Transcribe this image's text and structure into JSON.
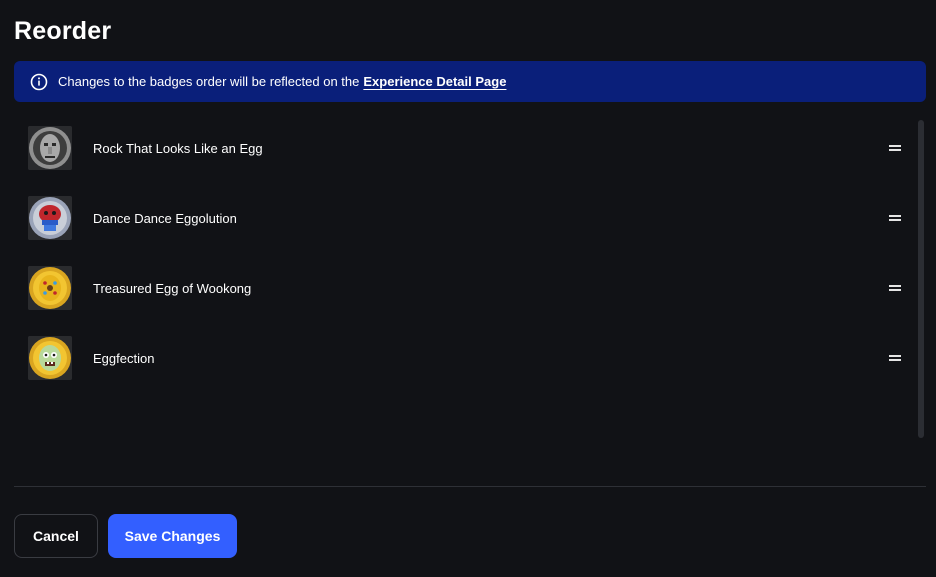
{
  "dialog": {
    "title": "Reorder"
  },
  "banner": {
    "icon": "info-icon",
    "text": "Changes to the badges order will be reflected on the",
    "link_label": "Experience Detail Page",
    "background": "#0a1f7a"
  },
  "badges": [
    {
      "name": "Rock That Looks Like an Egg",
      "icon": "stone-face-badge"
    },
    {
      "name": "Dance Dance Eggolution",
      "icon": "red-bird-badge"
    },
    {
      "name": "Treasured Egg of Wookong",
      "icon": "golden-egg-badge"
    },
    {
      "name": "Eggfection",
      "icon": "zombie-egg-badge"
    }
  ],
  "actions": {
    "cancel_label": "Cancel",
    "save_label": "Save Changes",
    "save_color": "#335fff"
  }
}
